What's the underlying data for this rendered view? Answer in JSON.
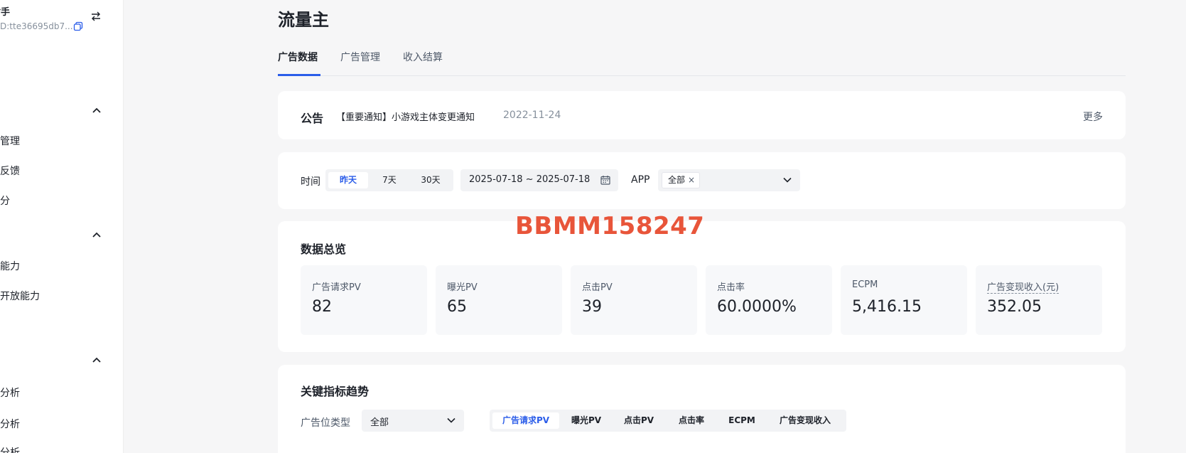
{
  "sidebar": {
    "account_name": "射手",
    "account_id": "D:tte36695db7...",
    "items": [
      {
        "label": "管理"
      },
      {
        "label": "反馈"
      },
      {
        "label": "分"
      },
      {
        "label": "能力"
      },
      {
        "label": "开放能力"
      },
      {
        "label": "分析"
      },
      {
        "label": "分析"
      },
      {
        "label": "分析"
      }
    ]
  },
  "page": {
    "title": "流量主"
  },
  "tabs": [
    {
      "label": "广告数据",
      "active": true
    },
    {
      "label": "广告管理",
      "active": false
    },
    {
      "label": "收入结算",
      "active": false
    }
  ],
  "notice": {
    "label": "公告",
    "text": "【重要通知】小游戏主体变更通知",
    "date": "2022-11-24",
    "more": "更多"
  },
  "filter": {
    "time_label": "时间",
    "time_options": [
      {
        "label": "昨天",
        "active": true
      },
      {
        "label": "7天",
        "active": false
      },
      {
        "label": "30天",
        "active": false
      }
    ],
    "date_range": "2025-07-18 ~ 2025-07-18",
    "app_label": "APP",
    "app_tag": "全部",
    "app_tag_remove": "×"
  },
  "watermark": "BBMM158247",
  "overview": {
    "title": "数据总览",
    "metrics": [
      {
        "label": "广告请求PV",
        "value": "82"
      },
      {
        "label": "曝光PV",
        "value": "65"
      },
      {
        "label": "点击PV",
        "value": "39"
      },
      {
        "label": "点击率",
        "value": "60.0000%"
      },
      {
        "label": "ECPM",
        "value": "5,416.15"
      },
      {
        "label": "广告变现收入(元)",
        "value": "352.05"
      }
    ]
  },
  "trend": {
    "title": "关键指标趋势",
    "ad_type_label": "广告位类型",
    "ad_type_value": "全部",
    "metric_options": [
      {
        "label": "广告请求PV",
        "active": true
      },
      {
        "label": "曝光PV",
        "active": false
      },
      {
        "label": "点击PV",
        "active": false
      },
      {
        "label": "点击率",
        "active": false
      },
      {
        "label": "ECPM",
        "active": false
      },
      {
        "label": "广告变现收入",
        "active": false
      }
    ]
  },
  "colors": {
    "accent": "#2b5de9",
    "watermark": "#e8553a",
    "background": "#f6f6f7"
  }
}
